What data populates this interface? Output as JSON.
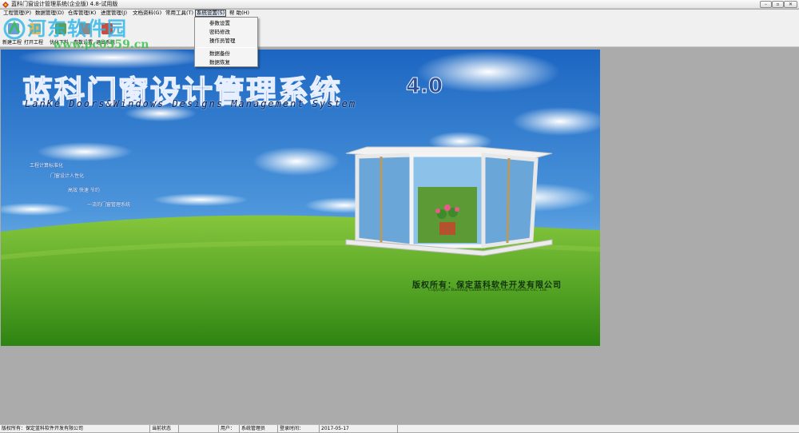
{
  "window": {
    "title": "蓝科门窗设计管理系统(企业版) 4.8-试用版",
    "min_glyph": "–",
    "max_glyph": "▫",
    "close_glyph": "✕"
  },
  "menu": [
    {
      "label": "工程管理(P)"
    },
    {
      "label": "数据管理(D)"
    },
    {
      "label": "仓库管理(K)"
    },
    {
      "label": "进度管理(J)"
    },
    {
      "label": "文档资料(G)"
    },
    {
      "label": "常用工具(T)"
    },
    {
      "label": "系统设置(S)",
      "active": true
    },
    {
      "label": "帮 助(H)"
    }
  ],
  "dropdown": {
    "items": [
      "参数设置",
      "密码修改",
      "操作员管理",
      "数据备份",
      "数据恢复"
    ]
  },
  "toolbar": {
    "buttons": [
      {
        "label": "新建工程",
        "icon": "new-project-icon"
      },
      {
        "label": "打开工程",
        "icon": "open-project-icon"
      },
      {
        "label": "优化下料",
        "icon": "optimize-icon"
      },
      {
        "label": "参数设置",
        "icon": "settings-icon"
      },
      {
        "label": "退出系统",
        "icon": "exit-icon"
      }
    ]
  },
  "watermark": {
    "cn": "河东软件园",
    "url": "www.pc0359.cn"
  },
  "splash": {
    "title": "蓝科门窗设计管理系统",
    "version": "4.0",
    "subtitle": "LanKe Doors&Windows Designs Management System",
    "features": [
      "工程计算标准化",
      "门窗设计人性化",
      "高效 快速 节约",
      "一流的门窗管理系统"
    ],
    "copyright": "版权所有：保定蓝科软件开发有限公司",
    "copyright_en": "Copyright: Baoding Lanke Software Development Co., Ltd."
  },
  "status": {
    "company": "版权所有：保定蓝科软件开发有限公司",
    "state_label": "当前状态",
    "user_label": "用户：",
    "user_value": "系统管理员",
    "login_label": "登录时间：",
    "login_value": "2017-05-17"
  },
  "colors": {
    "sky_top": "#1f6fc8",
    "sky_bottom": "#a9d6f4",
    "grass_light": "#7cc23a",
    "grass_dark": "#2f8a12",
    "title_blue": "#1f3f86"
  }
}
